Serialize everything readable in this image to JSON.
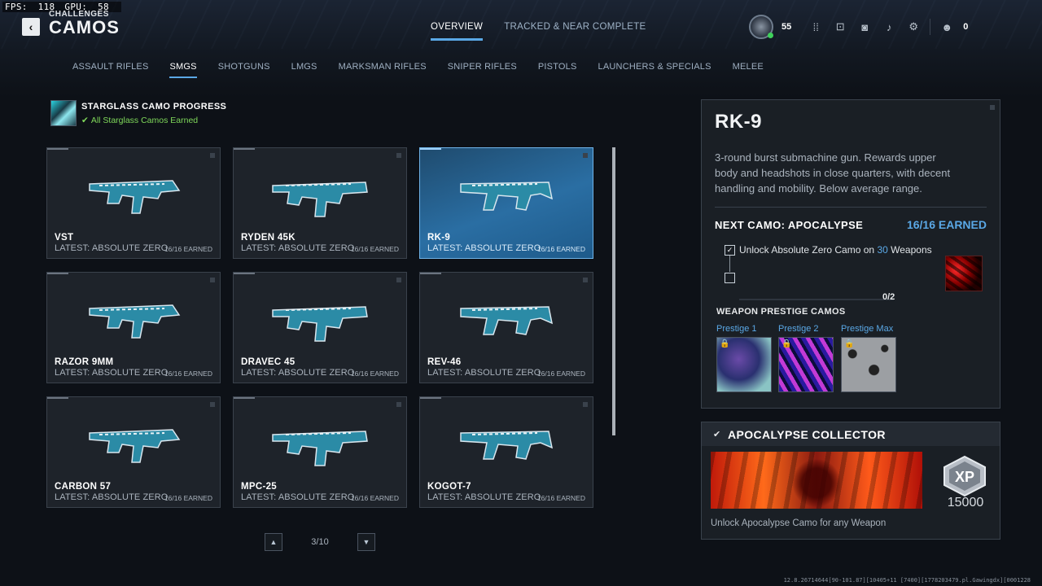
{
  "debug": {
    "fps_label": "FPS:",
    "fps_value": "118",
    "gpu_label": "GPU:",
    "gpu_value": "58"
  },
  "header": {
    "breadcrumb": "CHALLENGES",
    "title": "CAMOS",
    "tabs": [
      {
        "label": "OVERVIEW",
        "active": true
      },
      {
        "label": "TRACKED & NEAR COMPLETE",
        "active": false
      }
    ],
    "player_level": "55",
    "party_count": "0",
    "icons": [
      "grid-menu-icon",
      "loadout-icon",
      "camera-icon",
      "notification-bell-icon",
      "settings-gear-icon",
      "friends-icon"
    ]
  },
  "categories": [
    {
      "label": "ASSAULT RIFLES",
      "active": false
    },
    {
      "label": "SMGS",
      "active": true
    },
    {
      "label": "SHOTGUNS",
      "active": false
    },
    {
      "label": "LMGS",
      "active": false
    },
    {
      "label": "MARKSMAN RIFLES",
      "active": false
    },
    {
      "label": "SNIPER RIFLES",
      "active": false
    },
    {
      "label": "PISTOLS",
      "active": false
    },
    {
      "label": "LAUNCHERS & SPECIALS",
      "active": false
    },
    {
      "label": "MELEE",
      "active": false
    }
  ],
  "starglass": {
    "title": "STARGLASS CAMO PROGRESS",
    "status": "All Starglass Camos Earned"
  },
  "weapons": [
    {
      "name": "VST",
      "latest": "LATEST: ABSOLUTE ZERO",
      "earned": "16/16 EARNED"
    },
    {
      "name": "RYDEN 45K",
      "latest": "LATEST: ABSOLUTE ZERO",
      "earned": "16/16 EARNED"
    },
    {
      "name": "RK-9",
      "latest": "LATEST: ABSOLUTE ZERO",
      "earned": "16/16 EARNED",
      "selected": true
    },
    {
      "name": "RAZOR 9MM",
      "latest": "LATEST: ABSOLUTE ZERO",
      "earned": "16/16 EARNED"
    },
    {
      "name": "DRAVEC 45",
      "latest": "LATEST: ABSOLUTE ZERO",
      "earned": "16/16 EARNED"
    },
    {
      "name": "REV-46",
      "latest": "LATEST: ABSOLUTE ZERO",
      "earned": "16/16 EARNED"
    },
    {
      "name": "CARBON 57",
      "latest": "LATEST: ABSOLUTE ZERO",
      "earned": "16/16 EARNED"
    },
    {
      "name": "MPC-25",
      "latest": "LATEST: ABSOLUTE ZERO",
      "earned": "16/16 EARNED"
    },
    {
      "name": "KOGOT-7",
      "latest": "LATEST: ABSOLUTE ZERO",
      "earned": "16/16 EARNED"
    }
  ],
  "pager": {
    "label": "3/10"
  },
  "detail": {
    "title": "RK-9",
    "description": "3-round burst submachine gun. Rewards upper body and headshots in close quarters, with decent handling and mobility. Below average range.",
    "next_camo_label": "NEXT CAMO: APOCALYPSE",
    "next_camo_earned": "16/16 EARNED",
    "challenge_prefix": "Unlock Absolute Zero Camo on",
    "challenge_count": "30",
    "challenge_suffix": "Weapons",
    "progress": "0/2",
    "prestige_title": "WEAPON PRESTIGE CAMOS",
    "prestige": [
      {
        "label": "Prestige 1"
      },
      {
        "label": "Prestige 2"
      },
      {
        "label": "Prestige Max"
      }
    ]
  },
  "collector": {
    "title": "APOCALYPSE COLLECTOR",
    "xp_badge": "XP",
    "xp_value": "15000",
    "description": "Unlock Apocalypse Camo for any Weapon"
  },
  "footer": {
    "build": "12.8.26714644[90-101.87][10405+11 [7400][1778203479.pl.Gawingdx][0001228"
  },
  "colors": {
    "accent": "#5aa8e6",
    "success": "#7fd85a",
    "selected_card": "#2a6ea3"
  }
}
